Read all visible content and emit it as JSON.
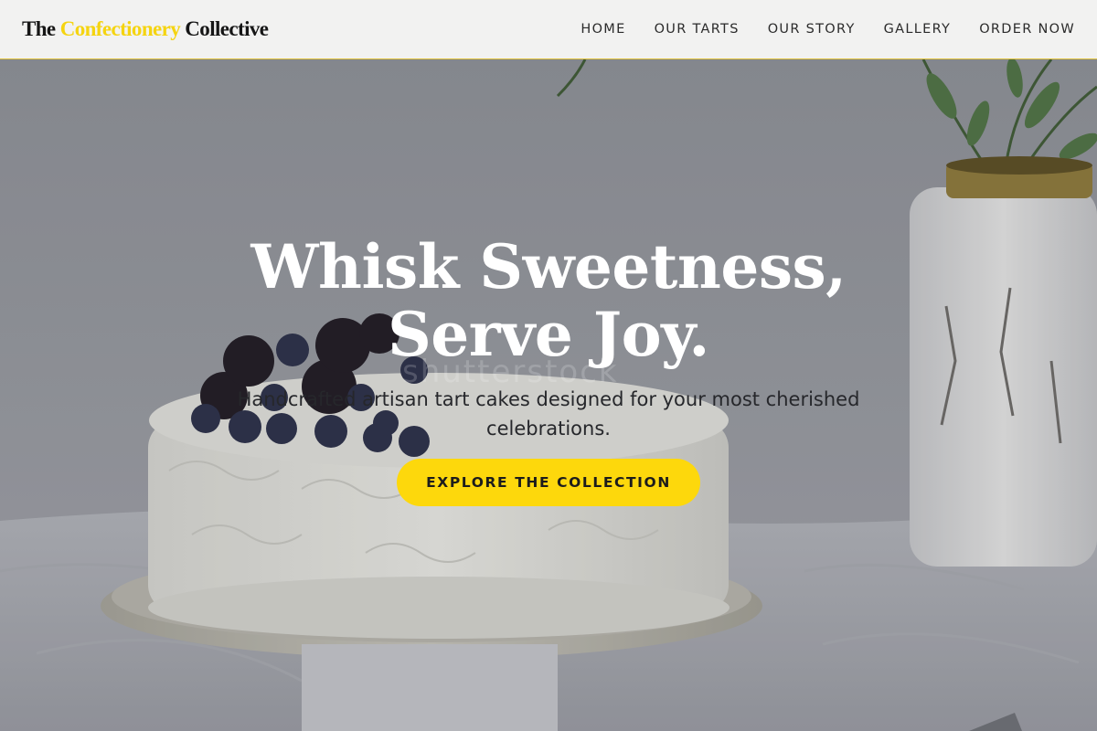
{
  "brand": {
    "name_prefix": "The",
    "name_accent": "Confectionery",
    "name_suffix": "Collective",
    "accent_color": "#f5d410"
  },
  "nav": {
    "items": [
      {
        "label": "HOME"
      },
      {
        "label": "OUR TARTS"
      },
      {
        "label": "OUR STORY"
      },
      {
        "label": "GALLERY"
      },
      {
        "label": "ORDER NOW"
      }
    ]
  },
  "hero": {
    "headline_line1": "Whisk Sweetness,",
    "headline_line2": "Serve Joy.",
    "watermark": "shutterstock",
    "subtitle": "Handcrafted artisan tart cakes designed for your most cherished celebrations.",
    "cta_label": "EXPLORE THE COLLECTION",
    "cta_color": "#fdd80c",
    "image_subject": "white frosted cake with blackberries and blueberries on a cake stand beside a white vase"
  }
}
